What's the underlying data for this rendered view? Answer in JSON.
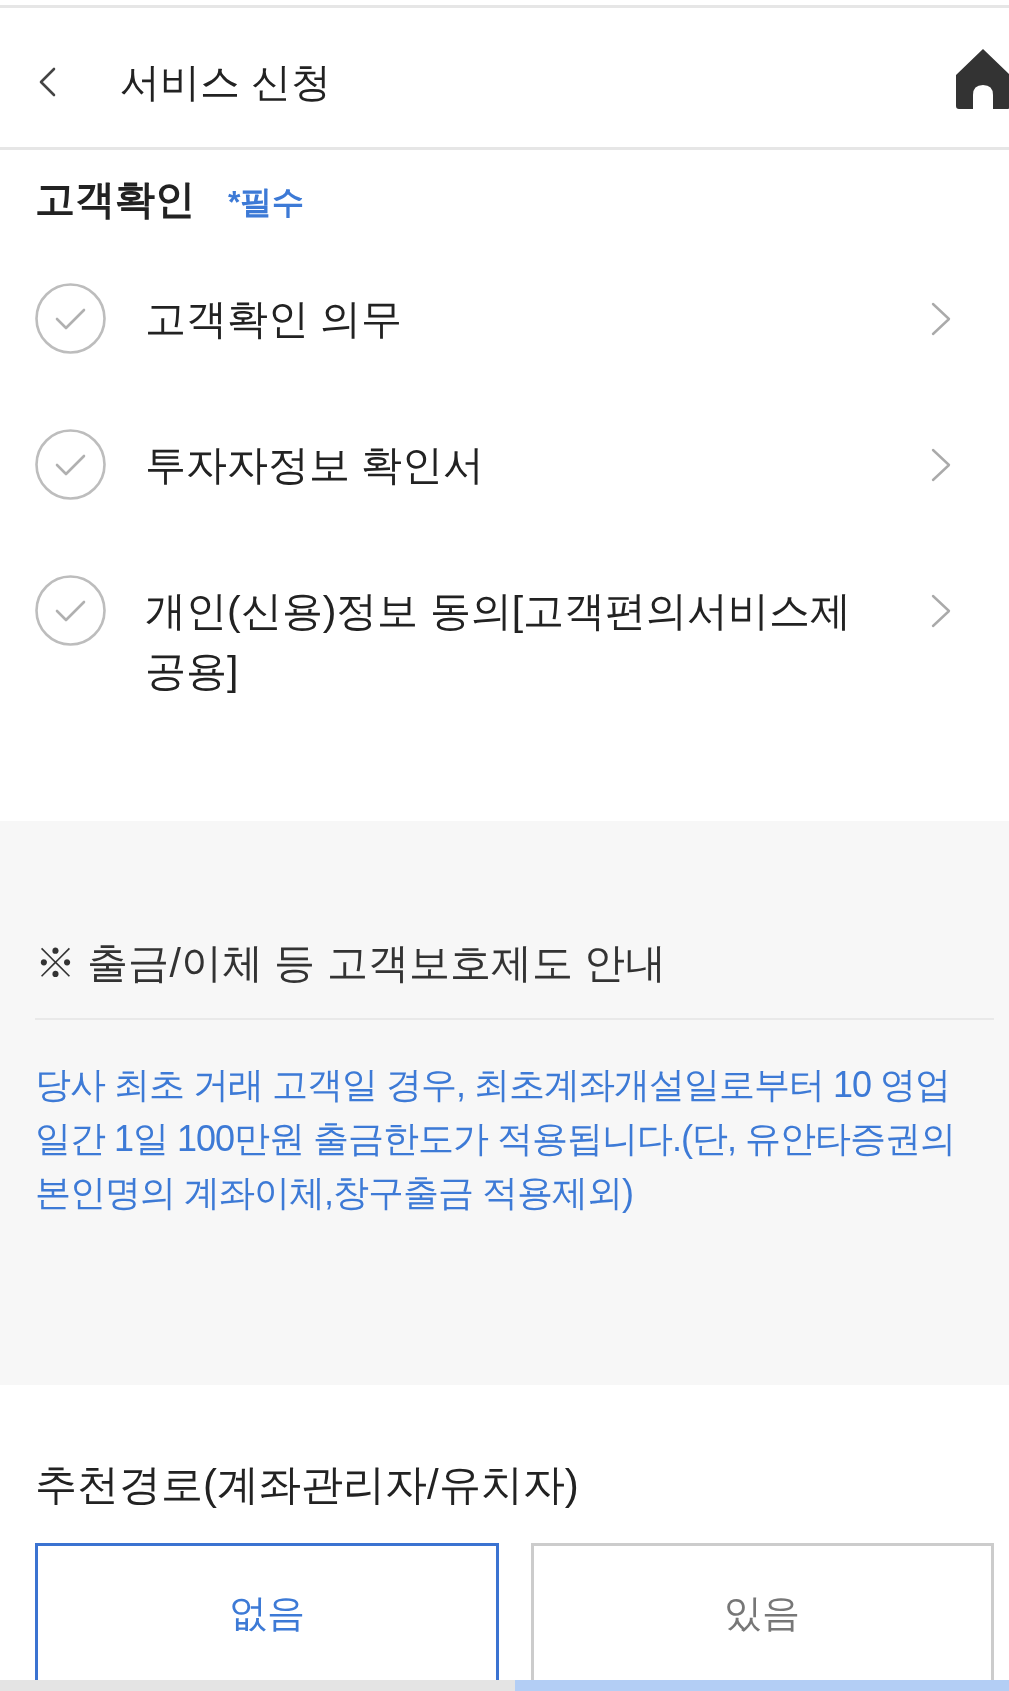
{
  "header": {
    "title": "서비스 신청"
  },
  "customer_check": {
    "title": "고객확인",
    "required_label": "*필수",
    "items": [
      {
        "label": "고객확인 의무",
        "checked": false
      },
      {
        "label": "투자자정보 확인서",
        "checked": false
      },
      {
        "label": "개인(신용)정보 동의[고객편의서비스제공용]",
        "checked": false
      }
    ]
  },
  "notice": {
    "title": "※ 출금/이체 등 고객보호제도 안내",
    "body": "당사 최초 거래 고객일 경우, 최초계좌개설일로부터 10 영업일간 1일 100만원 출금한도가 적용됩니다.(단, 유안타증권의 본인명의 계좌이체,창구출금 적용제외)"
  },
  "referral": {
    "title": "추천경로(계좌관리자/유치자)",
    "options": [
      {
        "label": "없음",
        "selected": true
      },
      {
        "label": "있음",
        "selected": false
      }
    ]
  },
  "footer": {
    "buttons": [
      {
        "kind": "secondary"
      },
      {
        "kind": "primary"
      }
    ]
  }
}
